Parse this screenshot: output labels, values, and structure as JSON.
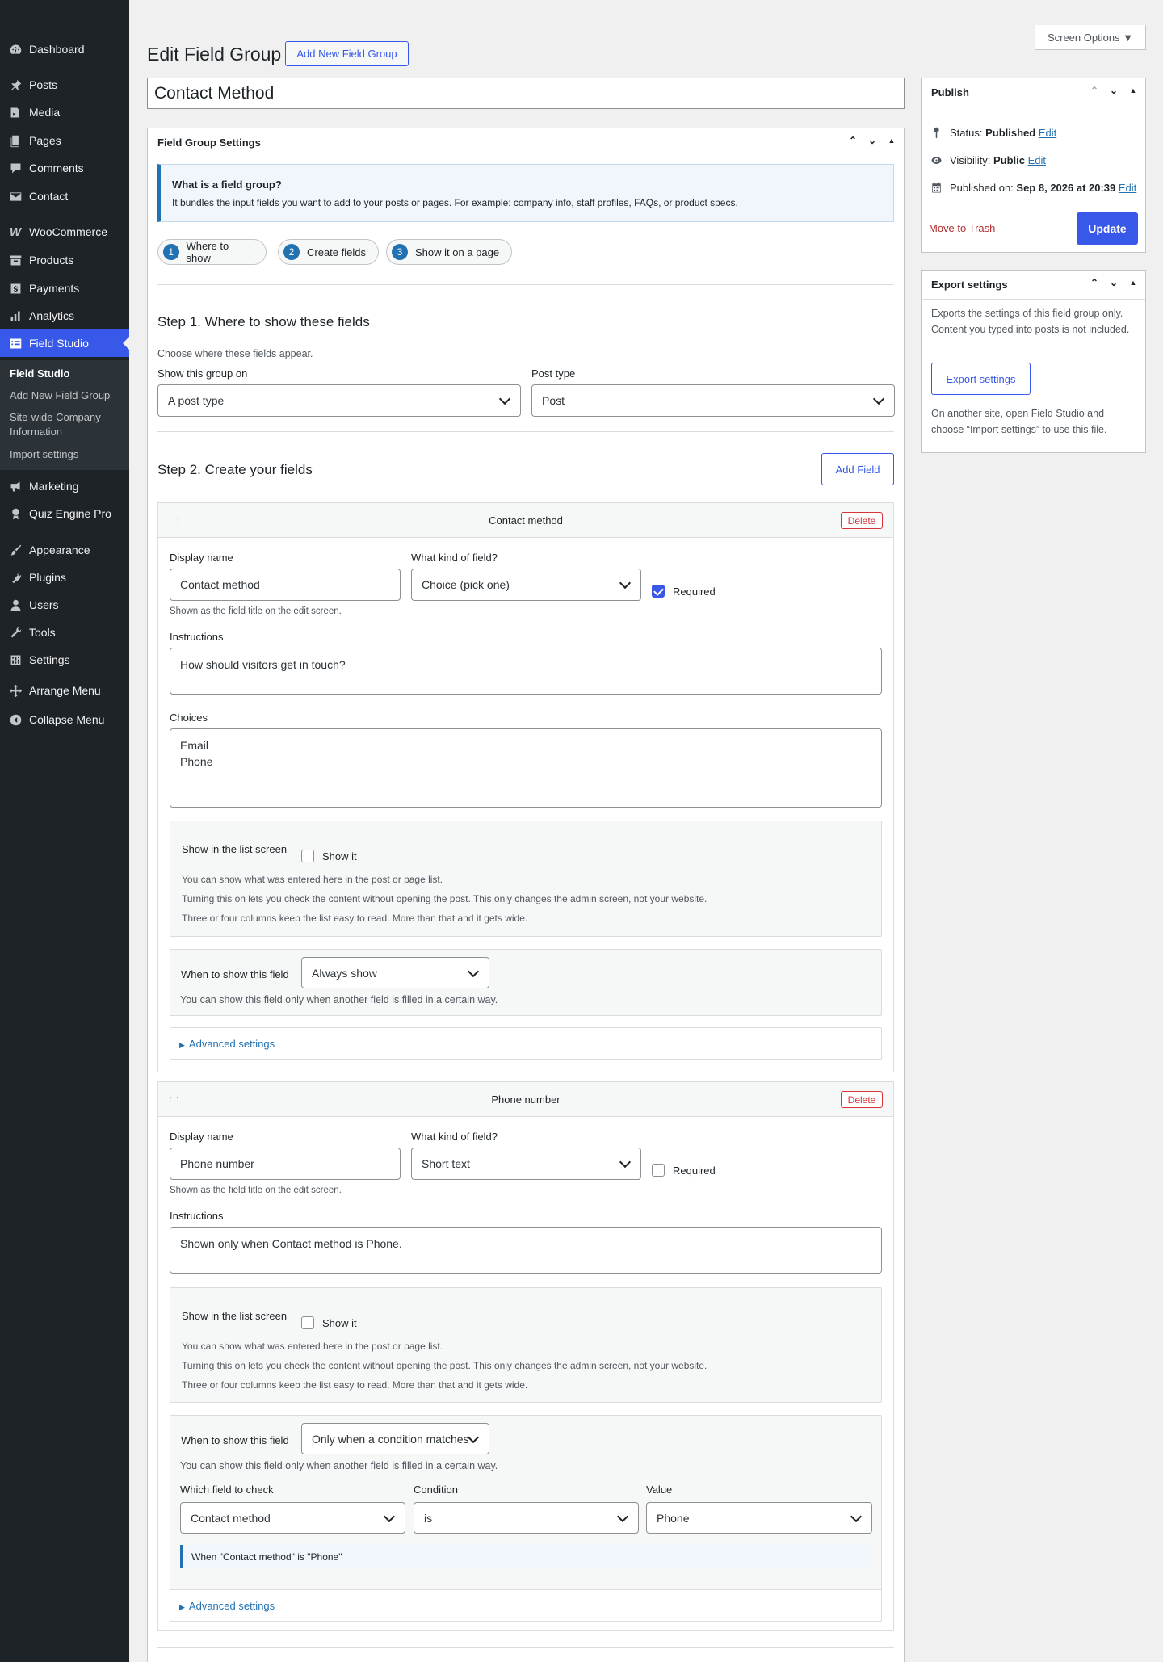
{
  "sidebar": {
    "items": [
      {
        "label": "Dashboard",
        "icon": "dashboard-icon"
      },
      {
        "label": "Posts",
        "icon": "pin-icon"
      },
      {
        "label": "Media",
        "icon": "media-icon"
      },
      {
        "label": "Pages",
        "icon": "pages-icon"
      },
      {
        "label": "Comments",
        "icon": "comment-icon"
      },
      {
        "label": "Contact",
        "icon": "envelope-icon"
      },
      {
        "label": "WooCommerce",
        "icon": "woo-icon"
      },
      {
        "label": "Products",
        "icon": "archive-icon"
      },
      {
        "label": "Payments",
        "icon": "payments-icon"
      },
      {
        "label": "Analytics",
        "icon": "chart-bar-icon"
      },
      {
        "label": "Field Studio",
        "icon": "field-studio-icon"
      },
      {
        "label": "Marketing",
        "icon": "megaphone-icon"
      },
      {
        "label": "Quiz Engine Pro",
        "icon": "award-icon"
      },
      {
        "label": "Appearance",
        "icon": "brush-icon"
      },
      {
        "label": "Plugins",
        "icon": "plug-icon"
      },
      {
        "label": "Users",
        "icon": "user-icon"
      },
      {
        "label": "Tools",
        "icon": "wrench-icon"
      },
      {
        "label": "Settings",
        "icon": "settings-icon"
      },
      {
        "label": "Arrange Menu",
        "icon": "move-icon"
      },
      {
        "label": "Collapse Menu",
        "icon": "collapse-icon"
      }
    ],
    "submenu": [
      "Field Studio",
      "Add New Field Group",
      "Site-wide Company Information",
      "Import settings"
    ]
  },
  "screen_options": "Screen Options ▼",
  "page_title": "Edit Field Group",
  "add_new_label": "Add New Field Group",
  "group_title": "Contact Method",
  "settings": {
    "title": "Field Group Settings",
    "info_title": "What is a field group?",
    "info_text": "It bundles the input fields you want to add to your posts or pages. For example: company info, staff profiles, FAQs, or product specs.",
    "steps": [
      {
        "num": "1",
        "label": "Where to show"
      },
      {
        "num": "2",
        "label": "Create fields"
      },
      {
        "num": "3",
        "label": "Show it on a page"
      }
    ],
    "step1_title": "Step 1. Where to show these fields",
    "step1_desc": "Choose where these fields appear.",
    "show_on_label": "Show this group on",
    "show_on_value": "A post type",
    "post_type_label": "Post type",
    "post_type_value": "Post",
    "step2_title": "Step 2. Create your fields",
    "add_field_label": "Add Field"
  },
  "fields": [
    {
      "header": "Contact method",
      "delete": "Delete",
      "display_name_label": "Display name",
      "display_name": "Contact method",
      "display_hint": "Shown as the field title on the edit screen.",
      "kind_label": "What kind of field?",
      "kind": "Choice (pick one)",
      "required_label": "Required",
      "instructions_label": "Instructions",
      "instructions": "How should visitors get in touch?",
      "choices_label": "Choices",
      "choices": "Email\nPhone",
      "list_label": "Show in the list screen",
      "show_it": "Show it",
      "list_desc": [
        "You can show what was entered here in the post or page list.",
        "Turning this on lets you check the content without opening the post. This only changes the admin screen, not your website.",
        "Three or four columns keep the list easy to read. More than that and it gets wide."
      ],
      "when_label": "When to show this field",
      "when_value": "Always show",
      "when_desc": "You can show this field only when another field is filled in a certain way.",
      "advanced": "Advanced settings"
    },
    {
      "header": "Phone number",
      "delete": "Delete",
      "display_name_label": "Display name",
      "display_name": "Phone number",
      "display_hint": "Shown as the field title on the edit screen.",
      "kind_label": "What kind of field?",
      "kind": "Short text",
      "required_label": "Required",
      "instructions_label": "Instructions",
      "instructions": "Shown only when Contact method is Phone.",
      "list_label": "Show in the list screen",
      "show_it": "Show it",
      "list_desc": [
        "You can show what was entered here in the post or page list.",
        "Turning this on lets you check the content without opening the post. This only changes the admin screen, not your website.",
        "Three or four columns keep the list easy to read. More than that and it gets wide."
      ],
      "when_label": "When to show this field",
      "when_value": "Only when a condition matches",
      "when_desc": "You can show this field only when another field is filled in a certain way.",
      "which_label": "Which field to check",
      "which_value": "Contact method",
      "condition_label": "Condition",
      "condition_value": "is",
      "value_label": "Value",
      "value_value": "Phone",
      "rule_summary": "When \"Contact method\" is \"Phone\"",
      "advanced": "Advanced settings"
    }
  ],
  "publish": {
    "title": "Publish",
    "status_label": "Status:",
    "status_value": "Published",
    "visibility_label": "Visibility:",
    "visibility_value": "Public",
    "published_label": "Published on:",
    "published_value": "Sep 8, 2026 at 20:39",
    "edit": "Edit",
    "trash": "Move to Trash",
    "update": "Update"
  },
  "export": {
    "title": "Export settings",
    "desc": "Exports the settings of this field group only. Content you typed into posts is not included.",
    "button": "Export settings",
    "note": "On another site, open Field Studio and choose “Import settings” to use this file."
  },
  "colors": {
    "accent": "#3858e9",
    "sidebar": "#1d2327",
    "delete": "#d63638",
    "link": "#2271b1"
  }
}
